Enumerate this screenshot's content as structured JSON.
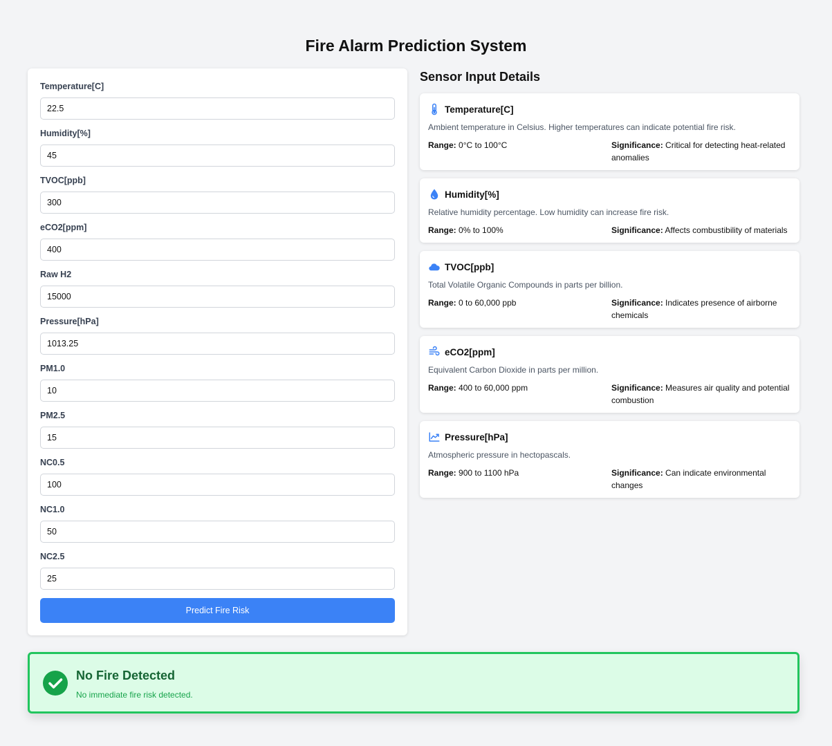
{
  "page": {
    "title": "Fire Alarm Prediction System"
  },
  "form": {
    "fields": [
      {
        "label": "Temperature[C]",
        "value": "22.5"
      },
      {
        "label": "Humidity[%]",
        "value": "45"
      },
      {
        "label": "TVOC[ppb]",
        "value": "300"
      },
      {
        "label": "eCO2[ppm]",
        "value": "400"
      },
      {
        "label": "Raw H2",
        "value": "15000"
      },
      {
        "label": "Pressure[hPa]",
        "value": "1013.25"
      },
      {
        "label": "PM1.0",
        "value": "10"
      },
      {
        "label": "PM2.5",
        "value": "15"
      },
      {
        "label": "NC0.5",
        "value": "100"
      },
      {
        "label": "NC1.0",
        "value": "50"
      },
      {
        "label": "NC2.5",
        "value": "25"
      }
    ],
    "submit_label": "Predict Fire Risk"
  },
  "details": {
    "title": "Sensor Input Details",
    "range_label": "Range:",
    "significance_label": "Significance:",
    "sensors": [
      {
        "icon": "thermometer-icon",
        "name": "Temperature[C]",
        "description": "Ambient temperature in Celsius. Higher temperatures can indicate potential fire risk.",
        "range": "0°C to 100°C",
        "significance": "Critical for detecting heat-related anomalies"
      },
      {
        "icon": "droplet-icon",
        "name": "Humidity[%]",
        "description": "Relative humidity percentage. Low humidity can increase fire risk.",
        "range": "0% to 100%",
        "significance": "Affects combustibility of materials"
      },
      {
        "icon": "cloud-icon",
        "name": "TVOC[ppb]",
        "description": "Total Volatile Organic Compounds in parts per billion.",
        "range": "0 to 60,000 ppb",
        "significance": "Indicates presence of airborne chemicals"
      },
      {
        "icon": "wind-icon",
        "name": "eCO2[ppm]",
        "description": "Equivalent Carbon Dioxide in parts per million.",
        "range": "400 to 60,000 ppm",
        "significance": "Measures air quality and potential combustion"
      },
      {
        "icon": "chart-line-icon",
        "name": "Pressure[hPa]",
        "description": "Atmospheric pressure in hectopascals.",
        "range": "900 to 1100 hPa",
        "significance": "Can indicate environmental changes"
      }
    ]
  },
  "result": {
    "icon": "check-circle-icon",
    "title": "No Fire Detected",
    "message": "No immediate fire risk detected.",
    "colors": {
      "background": "#dcfce7",
      "border": "#22c55e",
      "title": "#166534"
    }
  },
  "colors": {
    "accent": "#3b82f6",
    "background": "#f3f4f6"
  }
}
